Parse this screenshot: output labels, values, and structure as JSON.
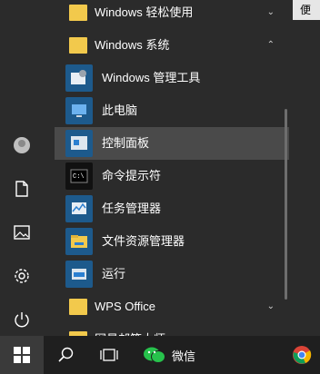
{
  "menu": {
    "items": [
      {
        "label": "Windows 轻松使用",
        "type": "folder",
        "chevron": "⌄"
      },
      {
        "label": "Windows 系统",
        "type": "folder",
        "chevron": "⌃"
      },
      {
        "label": "Windows 管理工具",
        "type": "app",
        "icon": "admin-tools-icon"
      },
      {
        "label": "此电脑",
        "type": "app",
        "icon": "this-pc-icon"
      },
      {
        "label": "控制面板",
        "type": "app",
        "icon": "control-panel-icon",
        "selected": true
      },
      {
        "label": "命令提示符",
        "type": "app",
        "icon": "cmd-icon"
      },
      {
        "label": "任务管理器",
        "type": "app",
        "icon": "task-manager-icon"
      },
      {
        "label": "文件资源管理器",
        "type": "app",
        "icon": "file-explorer-icon"
      },
      {
        "label": "运行",
        "type": "app",
        "icon": "run-icon"
      },
      {
        "label": "WPS Office",
        "type": "folder",
        "chevron": "⌄"
      },
      {
        "label": "网易邮箱大师",
        "type": "folder",
        "chevron": "⌄"
      }
    ]
  },
  "tile": {
    "label": "便笺"
  },
  "taskbar": {
    "wechat_label": "微信"
  },
  "colors": {
    "folder": "#f2c94c",
    "selected": "#4a4a4a",
    "background": "#2b2b2b"
  }
}
